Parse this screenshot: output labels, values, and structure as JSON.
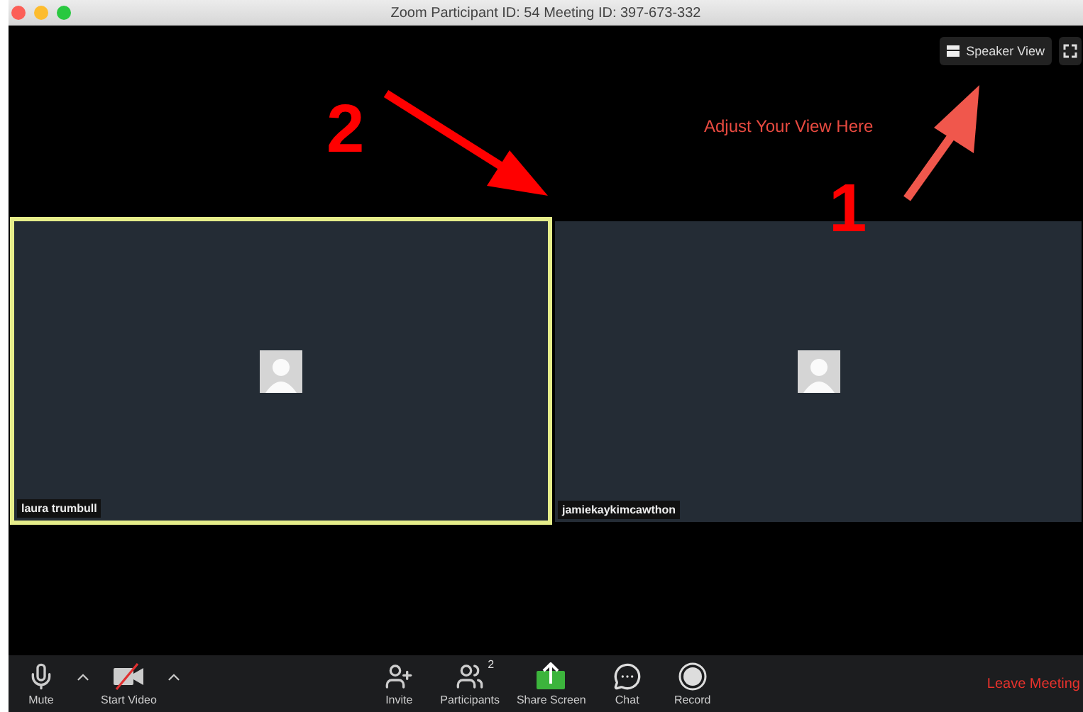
{
  "window": {
    "title": "Zoom Participant ID: 54   Meeting ID: 397-673-332"
  },
  "view_button": {
    "label": "Speaker View"
  },
  "tiles": [
    {
      "name": "laura trumbull",
      "active_speaker": true
    },
    {
      "name": "jamiekaykimcawthon",
      "active_speaker": false
    }
  ],
  "annotations": [
    {
      "kind": "callout",
      "number": "1",
      "text": "Adjust Your View Here"
    },
    {
      "kind": "arrow",
      "number": "2"
    }
  ],
  "toolbar": {
    "left": [
      {
        "kind": "mic",
        "label": "Mute"
      },
      {
        "kind": "chevron"
      },
      {
        "kind": "video_off",
        "label": "Start Video"
      },
      {
        "kind": "chevron"
      }
    ],
    "center": [
      {
        "kind": "invite",
        "label": "Invite"
      },
      {
        "kind": "participants",
        "label": "Participants",
        "count": "2"
      },
      {
        "kind": "share",
        "label": "Share Screen"
      },
      {
        "kind": "chat",
        "label": "Chat"
      },
      {
        "kind": "record",
        "label": "Record"
      }
    ],
    "leave": "Leave Meeting"
  }
}
